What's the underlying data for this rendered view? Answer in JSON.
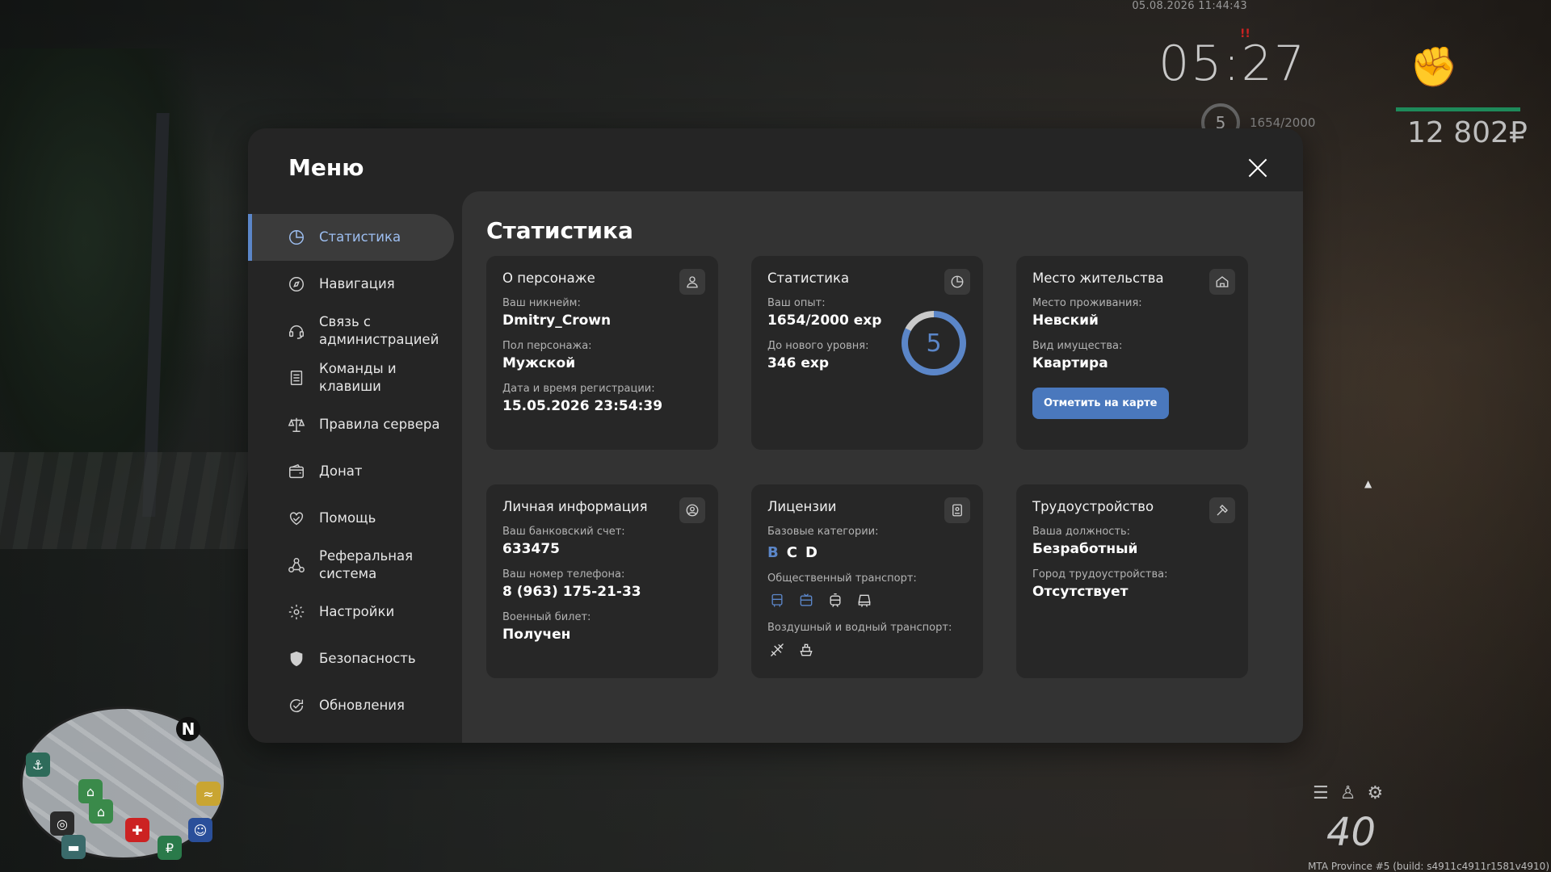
{
  "hud": {
    "datetime": "05.08.2026 11:44:43",
    "time": "05:27",
    "alert_mark": "!!",
    "level": "5",
    "exp": "1654/2000",
    "money": "12 802₽",
    "speed": "40",
    "build": "MTA Province #5 (build: s4911c4911r1581v4910)"
  },
  "minimap": {
    "north": "N"
  },
  "modal": {
    "title": "Меню",
    "sidebar": [
      {
        "label": "Статистика",
        "icon": "pie-chart-icon",
        "active": true
      },
      {
        "label": "Навигация",
        "icon": "compass-icon"
      },
      {
        "label": "Связь с администрацией",
        "icon": "headset-icon"
      },
      {
        "label": "Команды и клавиши",
        "icon": "document-icon"
      },
      {
        "label": "Правила сервера",
        "icon": "scales-icon"
      },
      {
        "label": "Донат",
        "icon": "wallet-icon"
      },
      {
        "label": "Помощь",
        "icon": "handshake-heart-icon"
      },
      {
        "label": "Реферальная система",
        "icon": "people-network-icon"
      },
      {
        "label": "Настройки",
        "icon": "gear-icon"
      },
      {
        "label": "Безопасность",
        "icon": "shield-icon"
      },
      {
        "label": "Обновления",
        "icon": "refresh-check-icon"
      }
    ]
  },
  "content": {
    "title": "Статистика",
    "about": {
      "title": "О персонаже",
      "nick_label": "Ваш никнейм:",
      "nick": "Dmitry_Crown",
      "gender_label": "Пол персонажа:",
      "gender": "Мужской",
      "reg_label": "Дата и время регистрации:",
      "reg": "15.05.2026 23:54:39"
    },
    "stats": {
      "title": "Статистика",
      "exp_label": "Ваш опыт:",
      "exp": "1654/2000 exp",
      "next_label": "До нового уровня:",
      "next": "346 exp",
      "level": "5",
      "progress": 0.827
    },
    "residence": {
      "title": "Место жительства",
      "place_label": "Место проживания:",
      "place": "Невский",
      "property_label": "Вид имущества:",
      "property": "Квартира",
      "map_button": "Отметить на карте"
    },
    "personal": {
      "title": "Личная информация",
      "bank_label": "Ваш банковский счет:",
      "bank": "633475",
      "phone_label": "Ваш номер телефона:",
      "phone": "8 (963) 175-21-33",
      "military_label": "Военный билет:",
      "military": "Получен"
    },
    "licenses": {
      "title": "Лицензии",
      "base_label": "Базовые категории:",
      "categories": [
        "B",
        "C",
        "D"
      ],
      "public_label": "Общественный транспорт:",
      "air_label": "Воздушный и водный транспорт:"
    },
    "job": {
      "title": "Трудоустройство",
      "position_label": "Ваша должность:",
      "position": "Безработный",
      "city_label": "Город трудоустройства:",
      "city": "Отсутствует"
    }
  },
  "colors": {
    "accent": "#5b86c8",
    "panel": "#252525",
    "content": "#333333",
    "card": "#272727",
    "money_bar": "#1e8a5a"
  }
}
